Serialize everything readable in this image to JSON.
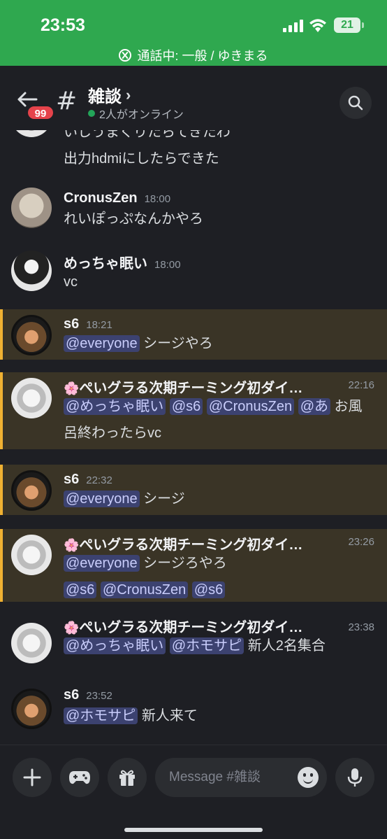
{
  "status": {
    "time": "23:53",
    "battery": "21",
    "call": "通話中: 一般 / ゆきまる",
    "accent": "#2fa84f"
  },
  "header": {
    "unread_badge": "99",
    "hash": "#",
    "channel": "雑談",
    "chevron": "›",
    "online": "2人がオンライン"
  },
  "messages": [
    {
      "partial": true,
      "lines": [
        "いしうまくりたらてきたわ",
        "出力hdmiにしたらできた"
      ]
    },
    {
      "user": "CronusZen",
      "time": "18:00",
      "text": "れいぽっぷなんかやろ"
    },
    {
      "user": "めっちゃ眠い",
      "time": "18:00",
      "text": "vc"
    },
    {
      "user": "s6",
      "time": "18:21",
      "mentions": [
        "@everyone"
      ],
      "text": "シージやろ"
    },
    {
      "user": "ぺいグラる次期チーミング初ダイ…",
      "flower": "🌸",
      "time": "22:16",
      "mentions": [
        "@めっちゃ眠い",
        "@s6",
        "@CronusZen",
        "@あ"
      ],
      "text": "お風",
      "text2": "呂終わったらvc"
    },
    {
      "user": "s6",
      "time": "22:32",
      "mentions": [
        "@everyone"
      ],
      "text": "シージ"
    },
    {
      "user": "ぺいグラる次期チーミング初ダイ…",
      "flower": "🌸",
      "time": "23:26",
      "mentions": [
        "@everyone"
      ],
      "text": "シージろやろ",
      "mentions2": [
        "@s6",
        "@CronusZen",
        "@s6"
      ]
    },
    {
      "user": "ぺいグラる次期チーミング初ダイ…",
      "flower": "🌸",
      "time": "23:38",
      "mentions": [
        "@めっちゃ眠い",
        "@ホモサピ"
      ],
      "text": "新人2名集合"
    },
    {
      "user": "s6",
      "time": "23:52",
      "mentions": [
        "@ホモサピ"
      ],
      "text": "新人来て"
    }
  ],
  "composer": {
    "placeholder": "Message #雑談",
    "plus_icon": "plus-icon",
    "games_icon": "gamepad-icon",
    "gift_icon": "gift-icon",
    "mic_icon": "mic-icon"
  }
}
